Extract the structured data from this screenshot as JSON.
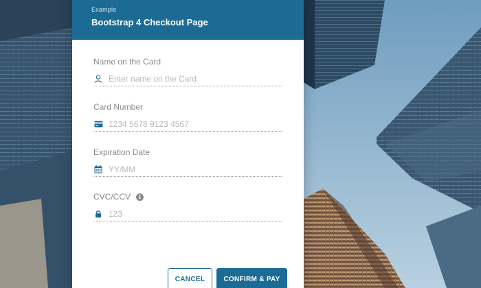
{
  "header": {
    "eyebrow": "Example",
    "title": "Bootstrap 4 Checkout Page"
  },
  "form": {
    "name": {
      "label": "Name on the Card",
      "placeholder": "Enter name on the Card",
      "icon": "user-icon"
    },
    "card_number": {
      "label": "Card Number",
      "placeholder": "1234 5678 9123 4567",
      "icon": "credit-card-icon"
    },
    "expiration": {
      "label": "Expiration Date",
      "placeholder": "YY/MM",
      "icon": "calendar-icon"
    },
    "cvc": {
      "label": "CVC/CCV",
      "placeholder": "123",
      "icon": "lock-icon",
      "info_icon": "info-icon",
      "info_glyph": "i"
    }
  },
  "actions": {
    "cancel_label": "CANCEL",
    "confirm_label": "CONFIRM & PAY"
  },
  "colors": {
    "accent": "#1b6b94",
    "label": "#8a8a8a",
    "placeholder": "#b8b8b8"
  }
}
